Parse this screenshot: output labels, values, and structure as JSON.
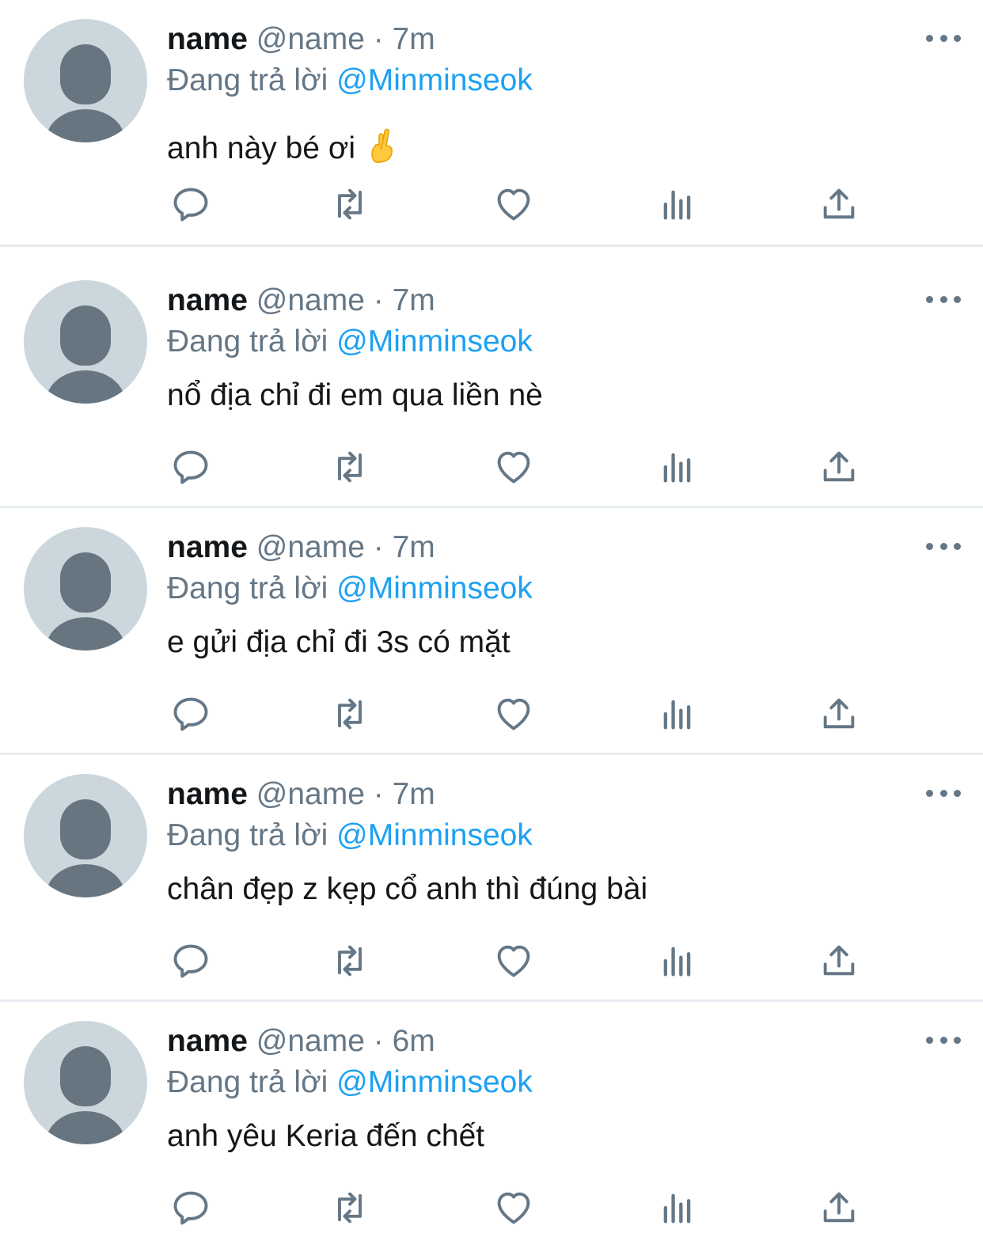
{
  "tweets": [
    {
      "display_name": "name",
      "handle": "@name",
      "separator": "·",
      "time": "7m",
      "reply_prefix": "Đang trả lời",
      "reply_to": "@Minminseok",
      "text": "anh này bé ơi",
      "emoji": "crossed-fingers-emoji"
    },
    {
      "display_name": "name",
      "handle": "@name",
      "separator": "·",
      "time": "7m",
      "reply_prefix": "Đang trả lời",
      "reply_to": "@Minminseok",
      "text": "nổ địa chỉ đi em qua liền nè"
    },
    {
      "display_name": "name",
      "handle": "@name",
      "separator": "·",
      "time": "7m",
      "reply_prefix": "Đang trả lời",
      "reply_to": "@Minminseok",
      "text": "e gửi địa chỉ đi 3s có mặt"
    },
    {
      "display_name": "name",
      "handle": "@name",
      "separator": "·",
      "time": "7m",
      "reply_prefix": "Đang trả lời",
      "reply_to": "@Minminseok",
      "text": "chân đẹp z kẹp cổ anh thì đúng bài"
    },
    {
      "display_name": "name",
      "handle": "@name",
      "separator": "·",
      "time": "6m",
      "reply_prefix": "Đang trả lời",
      "reply_to": "@Minminseok",
      "text": "anh yêu Keria đến chết"
    }
  ],
  "icons": {
    "reply": "reply-icon",
    "retweet": "retweet-icon",
    "like": "heart-icon",
    "analytics": "analytics-icon",
    "share": "share-icon",
    "more": "more-options-icon"
  },
  "colors": {
    "text": "#14171a",
    "secondary": "#657786",
    "mention": "#1da1f2",
    "avatar_bg": "#ccd6dd",
    "avatar_fg": "#66757f",
    "divider": "#e6ecf0"
  }
}
